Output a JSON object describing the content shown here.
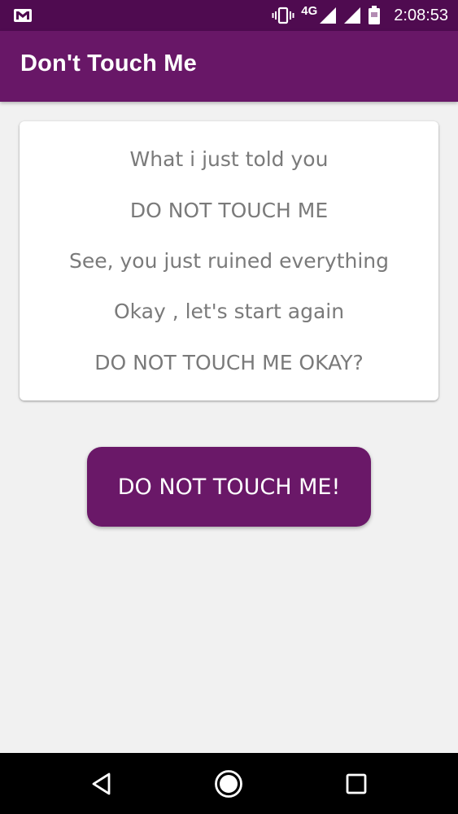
{
  "status_bar": {
    "time": "2:08:53",
    "network_type": "4G",
    "icons": [
      "gmail-icon",
      "vibrate-icon",
      "signal-icon",
      "signal-icon",
      "battery-icon"
    ],
    "icon_color": "#ffffff"
  },
  "app_bar": {
    "title": "Don't Touch Me",
    "color": "#681767"
  },
  "card": {
    "lines": [
      "What i just told you",
      "DO NOT TOUCH ME",
      "See, you just ruined everything",
      "Okay , let's start again",
      "DO NOT TOUCH ME OKAY?"
    ],
    "text_color": "#7a7a7a"
  },
  "main_button": {
    "label": "DO NOT TOUCH ME!",
    "color": "#6a1868"
  },
  "nav_bar": {
    "buttons": [
      "back-icon",
      "home-icon",
      "recents-icon"
    ]
  }
}
